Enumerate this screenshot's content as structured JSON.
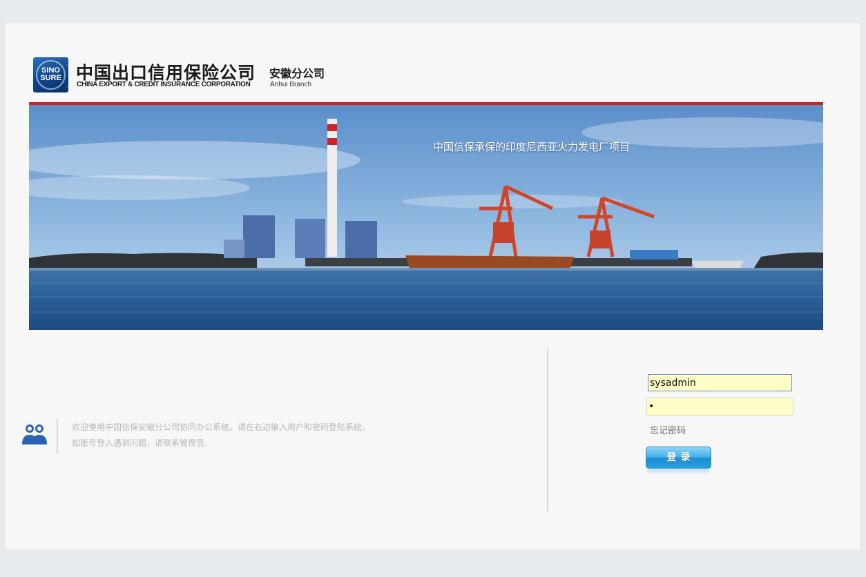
{
  "header": {
    "logo_line1": "SINO",
    "logo_line2": "SURE",
    "company_name_cn": "中国出口信用保险公司",
    "company_name_en": "CHINA EXPORT & CREDIT INSURANCE CORPORATION",
    "branch_name_cn": "安徽分公司",
    "branch_name_en": "Anhui Branch"
  },
  "banner": {
    "caption": "中国信保承保的印度尼西亚火力发电厂项目"
  },
  "welcome": {
    "line1": "欢迎使用中国信保安徽分公司协同办公系统。请在右边输入用户和密码登陆系统。",
    "line2": "如账号登入遇到问题，请联系管理员."
  },
  "login": {
    "username_value": "sysadmin",
    "password_value": "•",
    "remember_label": "忘记密码",
    "submit_label": "登录"
  },
  "colors": {
    "brand_red": "#d1202a",
    "brand_blue": "#0f4488",
    "input_bg": "#fffec8",
    "button_blue": "#1d8fd3"
  }
}
